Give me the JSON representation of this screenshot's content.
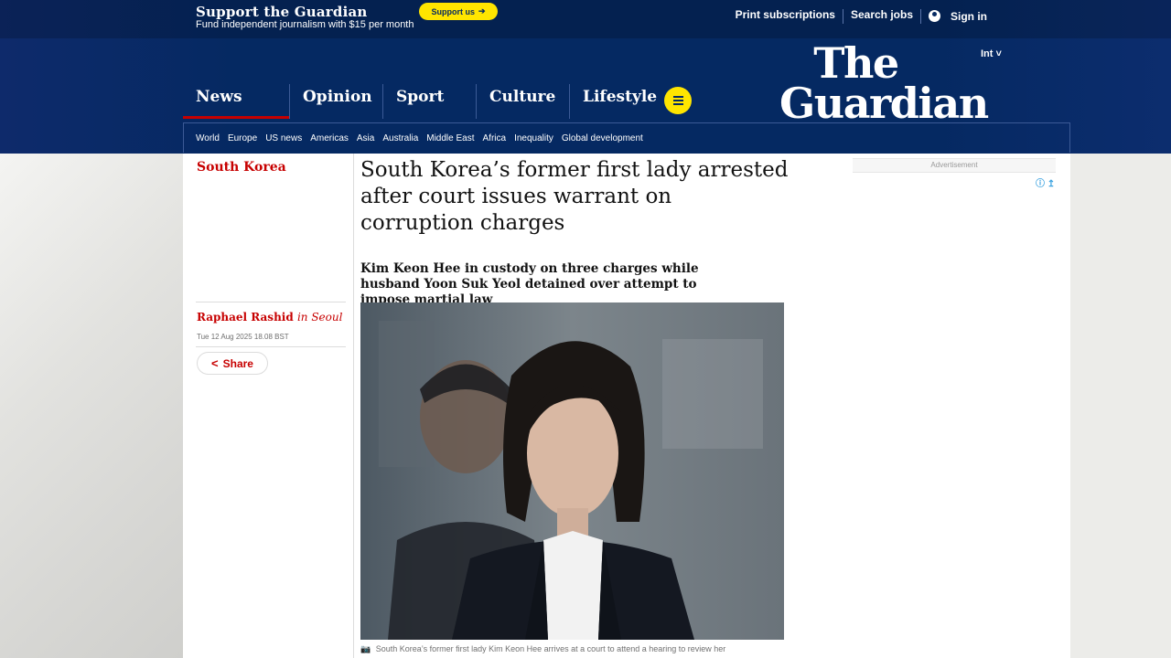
{
  "support_banner": {
    "title": "Support the Guardian",
    "subtitle": "Fund independent journalism with $15 per month",
    "button_label": "Support us"
  },
  "top_links": {
    "print_subscriptions": "Print subscriptions",
    "search_jobs": "Search jobs",
    "sign_in": "Sign in"
  },
  "logo": {
    "line1": "The",
    "line2": "Guardian"
  },
  "edition": "Int",
  "pillars": [
    {
      "label": "News",
      "active": true
    },
    {
      "label": "Opinion"
    },
    {
      "label": "Sport"
    },
    {
      "label": "Culture"
    },
    {
      "label": "Lifestyle"
    }
  ],
  "subnav": [
    "World",
    "Europe",
    "US news",
    "Americas",
    "Asia",
    "Australia",
    "Middle East",
    "Africa",
    "Inequality",
    "Global development"
  ],
  "article": {
    "section": "South Korea",
    "headline": "South Korea’s former first lady arrested after court issues warrant on corruption charges",
    "standfirst": "Kim Keon Hee in custody on three charges while husband Yoon Suk Yeol detained over attempt to impose martial law",
    "byline_name": "Raphael Rashid",
    "byline_location": "in Seoul",
    "date": "Tue 12 Aug 2025 18.08 BST",
    "share_label": "Share",
    "caption": "South Korea’s former first lady Kim Keon Hee arrives at a court to attend a hearing to review her"
  },
  "advertisement_label": "Advertisement",
  "colors": {
    "brand_blue": "#052962",
    "accent_red": "#c70000",
    "yellow": "#ffe500"
  }
}
